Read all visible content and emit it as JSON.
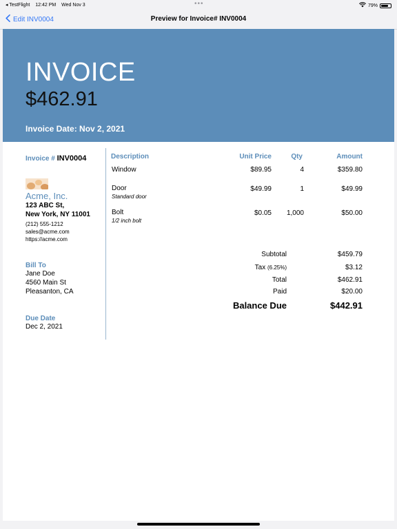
{
  "status_bar": {
    "carrier": "◂ TestFlight",
    "time": "12:42 PM",
    "date": "Wed Nov 3",
    "dots": "•••",
    "battery": "79%",
    "battery_level": 0.79
  },
  "nav": {
    "back_label": "Edit INV0004",
    "title": "Preview for Invoice# INV0004"
  },
  "header": {
    "title": "INVOICE",
    "amount": "$462.91",
    "date": "Invoice Date: Nov 2, 2021"
  },
  "invoice": {
    "number_label": "Invoice #",
    "number": "INV0004"
  },
  "company": {
    "name": "Acme, Inc.",
    "address1": "123 ABC St,",
    "address2": "New York, NY 11001",
    "phone": "(212) 555-1212",
    "email": "sales@acme.com",
    "website": "https://acme.com"
  },
  "bill_to": {
    "label": "Bill To",
    "name": "Jane Doe",
    "street": "4560 Main St",
    "city": "Pleasanton, CA"
  },
  "due": {
    "label": "Due Date",
    "date": "Dec 2, 2021"
  },
  "table": {
    "headers": {
      "description": "Description",
      "unit_price": "Unit Price",
      "qty": "Qty",
      "amount": "Amount"
    },
    "rows": [
      {
        "description": "Window",
        "detail": "",
        "unit_price": "$89.95",
        "qty": "4",
        "amount": "$359.80"
      },
      {
        "description": "Door",
        "detail": "Standard door",
        "unit_price": "$49.99",
        "qty": "1",
        "amount": "$49.99"
      },
      {
        "description": "Bolt",
        "detail": "1/2 inch bolt",
        "unit_price": "$0.05",
        "qty": "1,000",
        "amount": "$50.00"
      }
    ]
  },
  "totals": {
    "subtotal_label": "Subtotal",
    "subtotal": "$459.79",
    "tax_label": "Tax",
    "tax_rate": "(6.25%)",
    "tax": "$3.12",
    "total_label": "Total",
    "total": "$462.91",
    "paid_label": "Paid",
    "paid": "$20.00",
    "balance_label": "Balance Due",
    "balance": "$442.91"
  },
  "colors": {
    "accent": "#5c8db9",
    "link": "#3478f6"
  }
}
